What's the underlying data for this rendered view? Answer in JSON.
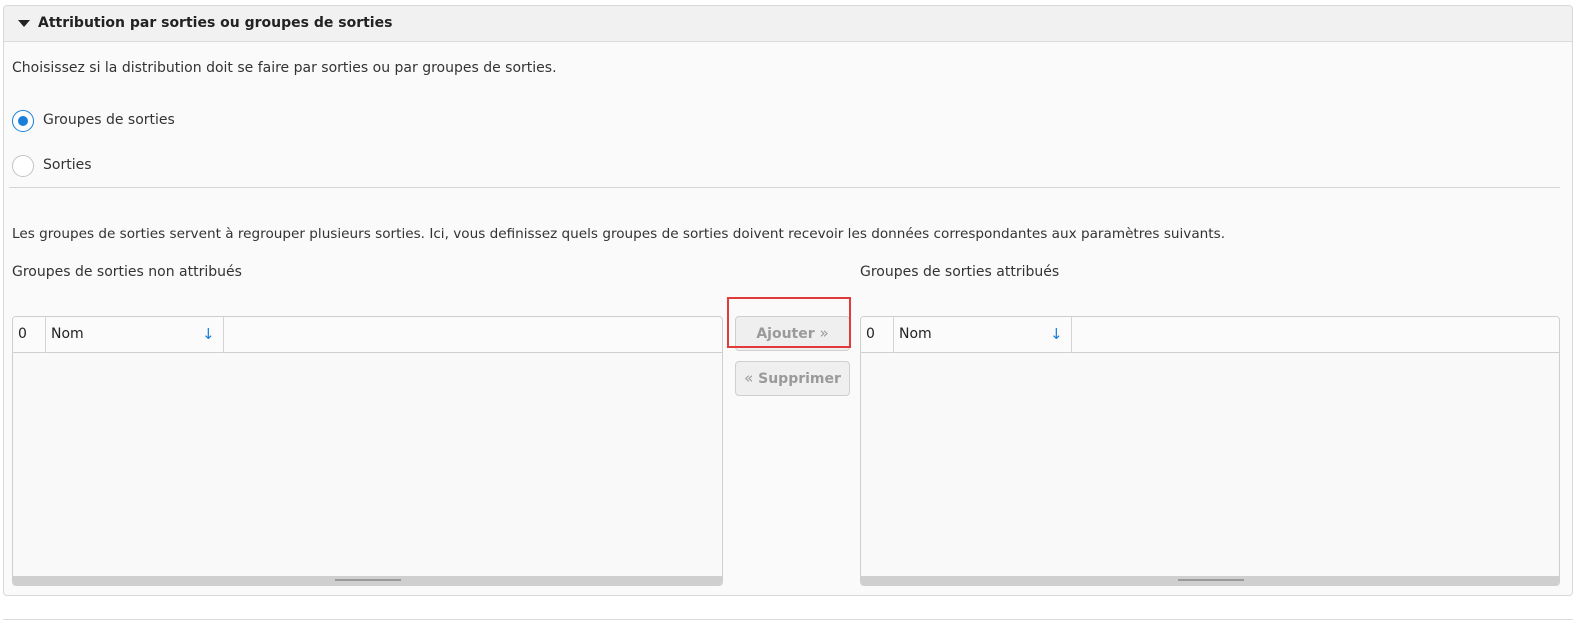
{
  "section": {
    "title": "Attribution par sorties ou groupes de sorties",
    "icons": {
      "collapse": "caret-down-icon"
    }
  },
  "mode": {
    "description": "Choisissez si la distribution doit se faire par sorties ou par groupes de sorties.",
    "options": [
      {
        "label": "Groupes de sorties",
        "selected": true
      },
      {
        "label": "Sorties",
        "selected": false
      }
    ]
  },
  "groups": {
    "description": "Les groupes de sorties servent à regrouper plusieurs sorties. Ici, vous definissez quels groupes de sorties doivent recevoir les données correspondantes aux paramètres suivants.",
    "unassigned": {
      "title": "Groupes de sorties non attribués",
      "count": "0",
      "column": "Nom",
      "sort_icon": "arrow-down-icon",
      "rows": []
    },
    "assigned": {
      "title": "Groupes de sorties attribués",
      "count": "0",
      "column": "Nom",
      "sort_icon": "arrow-down-icon",
      "rows": []
    },
    "buttons": {
      "add": {
        "label": "Ajouter",
        "icon": "chevrons-right-icon",
        "enabled": false
      },
      "remove": {
        "label": "Supprimer",
        "icon": "chevrons-left-icon",
        "enabled": false
      }
    }
  },
  "colors": {
    "accent": "#1a7fd9",
    "highlight": "#e03a3a",
    "disabled_text": "#9a9a9a"
  }
}
